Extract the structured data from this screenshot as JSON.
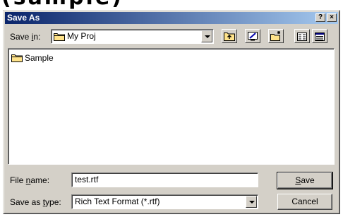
{
  "heading_fragment": "(sample)",
  "window": {
    "title": "Save As",
    "help_label": "?",
    "close_label": "×"
  },
  "save_in": {
    "label_prefix": "Save ",
    "label_mnemonic": "i",
    "label_suffix": "n:",
    "value": "My Proj"
  },
  "toolbar": {
    "icons": [
      "up-one-level-icon",
      "desktop-icon",
      "new-folder-icon",
      "list-view-icon",
      "details-view-icon"
    ]
  },
  "files": [
    {
      "name": "Sample",
      "icon": "folder-icon"
    }
  ],
  "file_name": {
    "label_prefix": "File ",
    "label_mnemonic": "n",
    "label_suffix": "ame:",
    "value": "test.rtf"
  },
  "save_as_type": {
    "label_prefix": "Save as ",
    "label_mnemonic": "t",
    "label_suffix": "ype:",
    "value": "Rich Text Format (*.rtf)"
  },
  "buttons": {
    "save_mnemonic": "S",
    "save_rest": "ave",
    "cancel": "Cancel"
  },
  "colors": {
    "title_start": "#0a246a",
    "title_end": "#a6caf0",
    "face": "#d4d0c8",
    "folder": "#ffe38a"
  }
}
